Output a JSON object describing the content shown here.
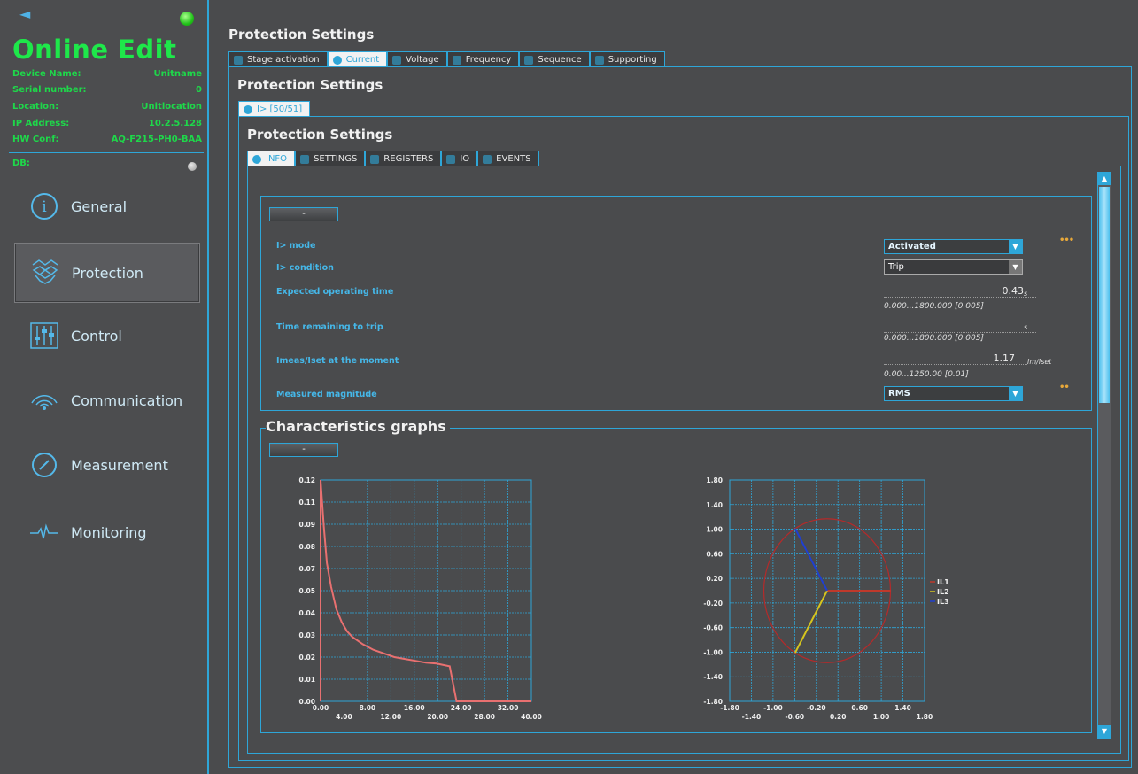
{
  "sidebar": {
    "title": "Online Edit",
    "device": [
      {
        "label": "Device Name:",
        "value": "Unitname"
      },
      {
        "label": "Serial number:",
        "value": "0"
      },
      {
        "label": "Location:",
        "value": "Unitlocation"
      },
      {
        "label": "IP Address:",
        "value": "10.2.5.128"
      },
      {
        "label": "HW Conf:",
        "value": "AQ-F215-PH0-BAA"
      }
    ],
    "db_label": "DB:",
    "nav": [
      {
        "label": "General",
        "icon": "info-icon"
      },
      {
        "label": "Protection",
        "icon": "protection-icon"
      },
      {
        "label": "Control",
        "icon": "sliders-icon"
      },
      {
        "label": "Communication",
        "icon": "wifi-icon"
      },
      {
        "label": "Measurement",
        "icon": "gauge-icon"
      },
      {
        "label": "Monitoring",
        "icon": "pulse-icon"
      }
    ]
  },
  "header": {
    "title": "Protection Settings",
    "tabs": [
      "Stage activation",
      "Current",
      "Voltage",
      "Frequency",
      "Sequence",
      "Supporting"
    ]
  },
  "level2": {
    "title": "Protection Settings",
    "tab": "I> [50/51]"
  },
  "level3": {
    "title": "Protection Settings",
    "tabs": [
      "INFO",
      "SETTINGS",
      "REGISTERS",
      "IO",
      "EVENTS"
    ]
  },
  "info": {
    "collapse_label": "-",
    "params": {
      "mode_label": "I> mode",
      "mode_value": "Activated",
      "condition_label": "I> condition",
      "condition_value": "Trip",
      "op_time_label": "Expected operating time",
      "op_time_value": "0.43",
      "op_time_unit": "s",
      "op_time_range": "0.000...1800.000 [0.005]",
      "remain_label": "Time remaining to trip",
      "remain_unit": "s",
      "remain_range": "0.000...1800.000 [0.005]",
      "imeas_label": "Imeas/Iset at the moment",
      "imeas_value": "1.17",
      "imeas_unit": "Im/Iset",
      "imeas_range": "0.00...1250.00 [0.01]",
      "magnitude_label": "Measured magnitude",
      "magnitude_value": "RMS"
    }
  },
  "graphs": {
    "title": "Characteristics graphs",
    "collapse_label": "-"
  },
  "chart_data": [
    {
      "type": "line",
      "x_ticks": [
        "0.00",
        "4.00",
        "8.00",
        "12.00",
        "16.00",
        "20.00",
        "24.00",
        "28.00",
        "32.00",
        "40.00"
      ],
      "y_ticks": [
        "0.00",
        "0.01",
        "0.02",
        "0.03",
        "0.04",
        "0.05",
        "0.07",
        "0.08",
        "0.09",
        "0.11",
        "0.12"
      ],
      "xlim": [
        0,
        40
      ],
      "ylim": [
        0,
        0.12
      ],
      "grid": true,
      "series": [
        {
          "color": "#e87070",
          "points": [
            [
              0.0,
              0.12
            ],
            [
              0.0,
              0.0
            ],
            [
              0.0,
              0.12
            ],
            [
              0.6,
              0.095
            ],
            [
              1.2,
              0.075
            ],
            [
              2,
              0.062
            ],
            [
              3,
              0.05
            ],
            [
              4,
              0.043
            ],
            [
              5,
              0.038
            ],
            [
              6,
              0.035
            ],
            [
              8,
              0.031
            ],
            [
              10,
              0.028
            ],
            [
              12,
              0.026
            ],
            [
              14,
              0.024
            ],
            [
              16,
              0.023
            ],
            [
              18,
              0.022
            ],
            [
              20,
              0.021
            ],
            [
              22,
              0.0205
            ],
            [
              24.5,
              0.019
            ],
            [
              25.8,
              0.0
            ],
            [
              40,
              0.0
            ]
          ]
        }
      ]
    },
    {
      "type": "line",
      "x_ticks": [
        "-1.80",
        "-1.40",
        "-1.00",
        "-0.60",
        "-0.20",
        "0.20",
        "0.60",
        "1.00",
        "1.40",
        "1.80"
      ],
      "y_ticks": [
        "1.80",
        "1.40",
        "1.00",
        "0.60",
        "0.20",
        "-0.20",
        "-0.60",
        "-1.00",
        "-1.40",
        "-1.80"
      ],
      "xlim": [
        -1.8,
        1.8
      ],
      "ylim": [
        -1.8,
        1.8
      ],
      "grid": true,
      "circle_radius": 1.17,
      "legend_position": "right",
      "series": [
        {
          "name": "IL1",
          "color": "#c0392b",
          "points": [
            [
              0,
              0
            ],
            [
              1.17,
              0
            ]
          ]
        },
        {
          "name": "IL2",
          "color": "#d6c51e",
          "points": [
            [
              0,
              0
            ],
            [
              -0.59,
              -1.01
            ]
          ]
        },
        {
          "name": "IL3",
          "color": "#1f3fd1",
          "points": [
            [
              0,
              0
            ],
            [
              -0.59,
              1.01
            ]
          ]
        }
      ]
    }
  ]
}
